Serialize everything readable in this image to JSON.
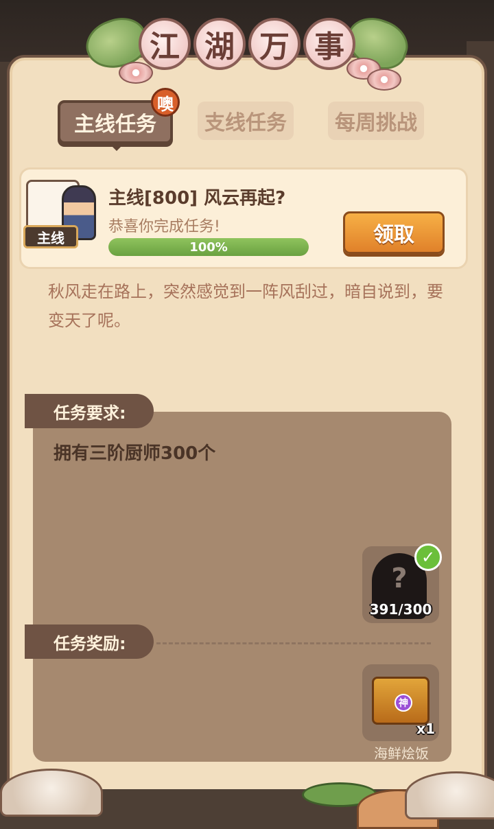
{
  "title": {
    "chars": [
      "江",
      "湖",
      "万",
      "事"
    ]
  },
  "tabs": [
    {
      "label": "主线任务",
      "active": true
    },
    {
      "label": "支线任务",
      "active": false
    },
    {
      "label": "每周挑战",
      "active": false
    }
  ],
  "tab_badge": "噢",
  "task": {
    "tag": "主线",
    "title": "主线[800] 风云再起?",
    "subtitle": "恭喜你完成任务!",
    "progress_label": "100%",
    "progress_fraction": 1.0,
    "claim_label": "领取"
  },
  "story": "秋风走在路上，突然感觉到一阵风刮过，暗自说到，要变天了呢。",
  "requirement": {
    "label": "任务要求:",
    "text": "拥有三阶厨师300个",
    "slot_icon": "mystery-character-icon",
    "slot_symbol": "?",
    "count": "391/300",
    "complete_mark": "✓"
  },
  "reward": {
    "label": "任务奖励:",
    "item_icon": "treasure-chest-icon",
    "seal": "神",
    "quantity": "x1",
    "name": "海鲜烩饭"
  },
  "colors": {
    "panel": "#f2dfc0",
    "panel_border": "#6e5343",
    "tab_active": "#8f7060",
    "claim_button": "#f0a03a",
    "progress_fill": "#7bb34e",
    "req_box": "#a6896f"
  }
}
